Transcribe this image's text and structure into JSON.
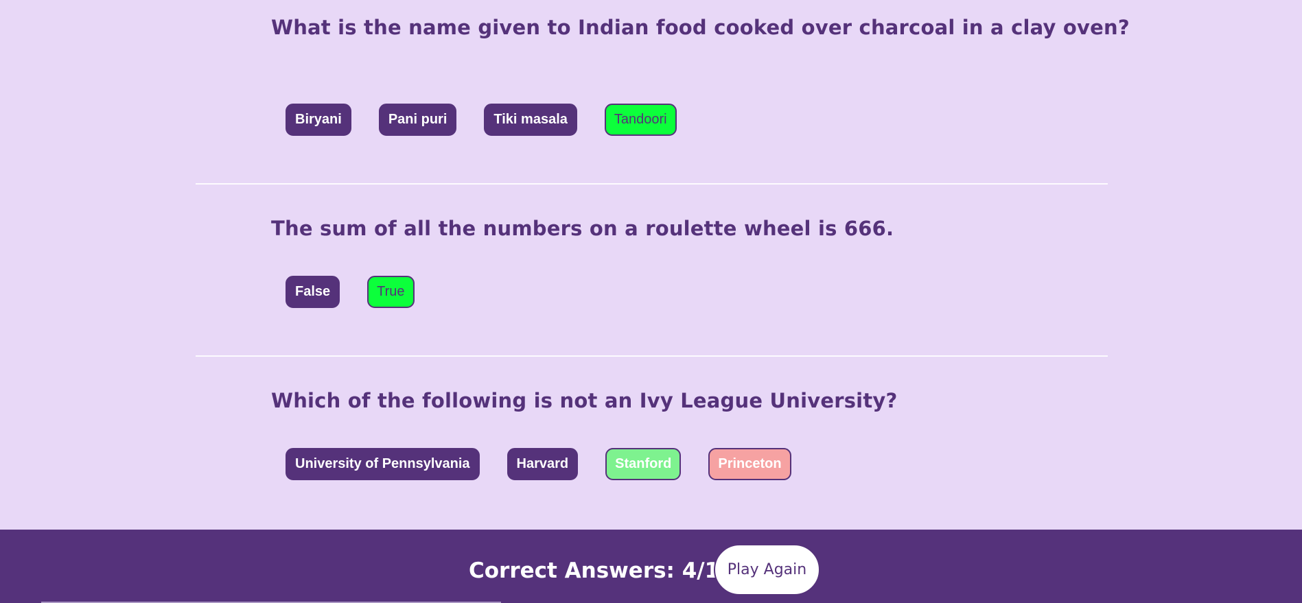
{
  "questions": [
    {
      "text": "What is the name given to Indian food cooked over charcoal in a clay oven?",
      "answers": [
        {
          "label": "Biryani",
          "state": "default"
        },
        {
          "label": "Pani puri",
          "state": "default"
        },
        {
          "label": "Tiki masala",
          "state": "default"
        },
        {
          "label": "Tandoori",
          "state": "correct-picked"
        }
      ]
    },
    {
      "text": "The sum of all the numbers on a roulette wheel is 666.",
      "answers": [
        {
          "label": "False",
          "state": "default"
        },
        {
          "label": "True",
          "state": "correct-picked"
        }
      ]
    },
    {
      "text": "Which of the following is not an Ivy League University?",
      "answers": [
        {
          "label": "University of Pennsylvania",
          "state": "default"
        },
        {
          "label": "Harvard",
          "state": "default"
        },
        {
          "label": "Stanford",
          "state": "correct-missed"
        },
        {
          "label": "Princeton",
          "state": "wrong-picked"
        }
      ]
    }
  ],
  "footer": {
    "score_text": "Correct Answers: 4/10",
    "play_again_label": "Play Again"
  },
  "colors": {
    "background": "#e8d8f7",
    "primary": "#55327a",
    "correct_selected": "#0cff3b",
    "correct_unselected": "#7ef28f",
    "incorrect_selected": "#f6a2a2"
  }
}
